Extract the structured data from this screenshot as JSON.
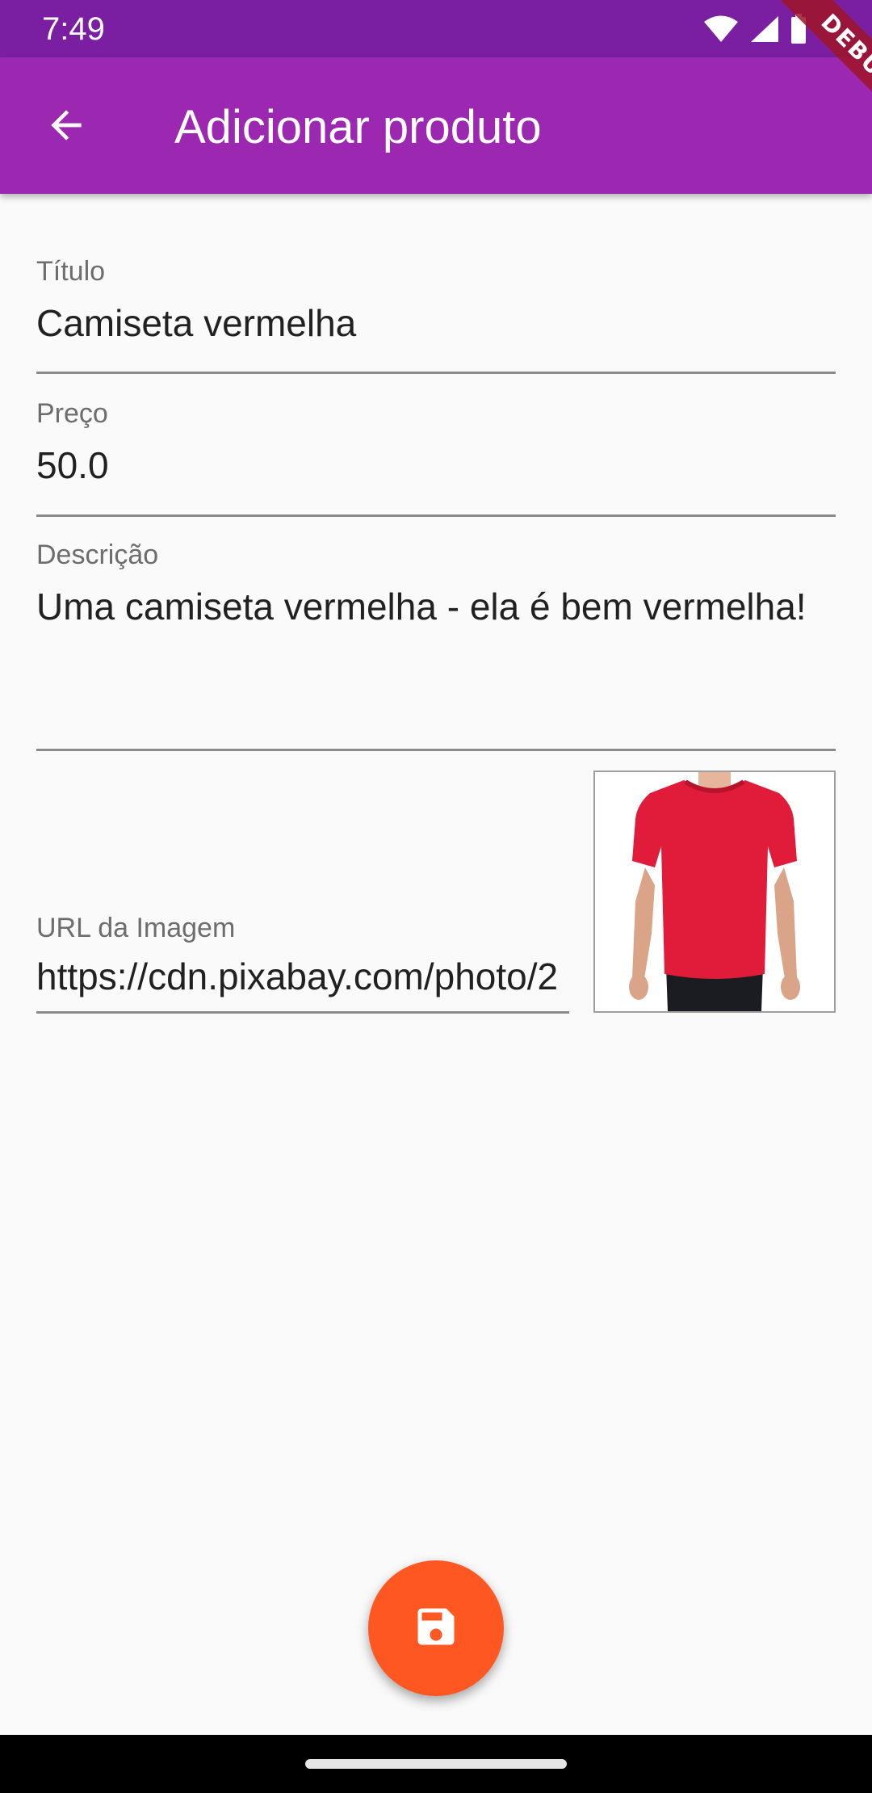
{
  "status_bar": {
    "time": "7:49",
    "icons": [
      "wifi-icon",
      "cellular-signal-icon",
      "battery-icon"
    ]
  },
  "debug_banner": {
    "label": "DEBUG"
  },
  "app_bar": {
    "title": "Adicionar produto",
    "back_icon": "arrow-back-icon",
    "background": "#9c27b0",
    "status_bar_color": "#7b1fa2"
  },
  "form": {
    "title": {
      "label": "Título",
      "value": "Camiseta vermelha"
    },
    "price": {
      "label": "Preço",
      "value": "50.0"
    },
    "description": {
      "label": "Descrição",
      "value": "Uma camiseta vermelha - ela é bem vermelha!"
    },
    "image_url": {
      "label": "URL da Imagem",
      "value": "https://cdn.pixabay.com/photo/2"
    },
    "image_preview": "red-tshirt-photo"
  },
  "fab": {
    "icon": "save-icon",
    "color": "#ff5722"
  }
}
